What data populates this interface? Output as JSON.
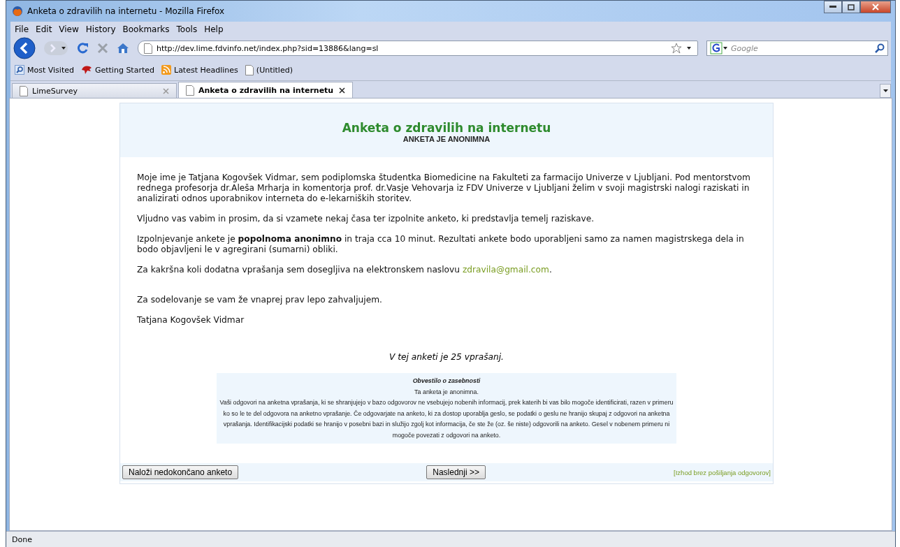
{
  "window": {
    "title": "Anketa o zdravilih na internetu - Mozilla Firefox"
  },
  "menu": [
    "File",
    "Edit",
    "View",
    "History",
    "Bookmarks",
    "Tools",
    "Help"
  ],
  "address": {
    "value": "http://dev.lime.fdvinfo.net/index.php?sid=13886&lang=sl"
  },
  "search": {
    "placeholder": "Google"
  },
  "bookmarks": [
    {
      "label": "Most Visited",
      "kind": "search"
    },
    {
      "label": "Getting Started",
      "kind": "fox"
    },
    {
      "label": "Latest Headlines",
      "kind": "rss"
    },
    {
      "label": "(Untitled)",
      "kind": "page"
    }
  ],
  "tabs": [
    {
      "label": "LimeSurvey",
      "selected": false
    },
    {
      "label": "Anketa o zdravilih na internetu",
      "selected": true
    }
  ],
  "survey": {
    "title": "Anketa o zdravilih na internetu",
    "subtitle": "ANKETA JE ANONIMNA",
    "paragraphs": [
      {
        "text": "Moje ime je Tatjana Kogovšek Vidmar, sem podiplomska študentka Biomedicine na Fakulteti za farmacijo Univerze v Ljubljani. Pod mentorstvom rednega profesorja dr.Aleša Mrharja in komentorja prof. dr.Vasje Vehovarja iz FDV Univerze v Ljubljani želim v svoji magistrski nalogi raziskati in analizirati odnos uporabnikov interneta do e-lekarniških storitev."
      },
      {
        "text": "Vljudno vas vabim in prosim, da si vzamete nekaj časa ter izpolnite anketo, ki predstavlja temelj raziskave."
      },
      {
        "text": "Izpolnjevanje ankete je **popolnoma anonimno** in traja cca 10 minut. Rezultati ankete bodo uporabljeni samo za namen magistrskega dela in bodo objavljeni le v agregirani (sumarni) obliki."
      },
      {
        "text": "Za kakršna koli dodatna vprašanja sem dosegljiva na elektronskem naslovu ",
        "link": "zdravila@gmail.com",
        "after": "."
      },
      {
        "text": "Za sodelovanje se vam že vnaprej prav lepo zahvaljujem.",
        "gap": true
      },
      {
        "text": "Tatjana Kogovšek Vidmar"
      }
    ],
    "question_count": "V tej anketi je 25 vprašanj.",
    "privacy": {
      "title": "Obvestilo o zasebnosti",
      "lines": [
        "Ta anketa je anonimna.",
        "Vaši odgovori na anketna vprašanja, ki se shranjujejo v bazo odgovorov ne vsebujejo nobenih informacij, prek katerih bi vas bilo mogoče identificirati, razen v primeru ko so le te del odgovora na anketno vprašanje. Če odgovarjate na anketo, ki za dostop uporablja geslo, se podatki o geslu ne hranijo skupaj z odgovori na anketna vprašanja. Identifikacijski podatki se hranijo v posebni bazi in služijo zgolj kot informacija, če ste že (oz. še niste) odgovorili na anketo. Gesel v nobenem primeru ni mogoče povezati z odgovori na anketo."
      ]
    },
    "buttons": {
      "load": "Naloži nedokončano anketo",
      "next": "Naslednji >>",
      "exit": "[Izhod brez pošiljanja odgovorov]"
    }
  },
  "status_bar": "Done"
}
